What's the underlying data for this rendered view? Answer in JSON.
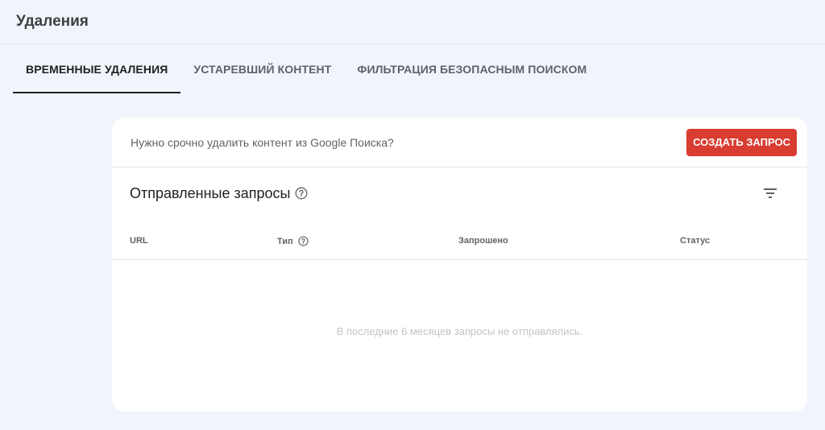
{
  "page": {
    "title": "Удаления"
  },
  "tabs": [
    {
      "label": "ВРЕМЕННЫЕ УДАЛЕНИЯ",
      "active": true
    },
    {
      "label": "УСТАРЕВШИЙ КОНТЕНТ",
      "active": false
    },
    {
      "label": "ФИЛЬТРАЦИЯ БЕЗОПАСНЫМ ПОИСКОМ",
      "active": false
    }
  ],
  "banner": {
    "text": "Нужно срочно удалить контент из Google Поиска?",
    "button_label": "СОЗДАТЬ ЗАПРОС"
  },
  "requests": {
    "title": "Отправленные запросы",
    "columns": [
      "URL",
      "Тип",
      "Запрошено",
      "Статус"
    ],
    "empty_text": "В последние 6 месяцев запросы не отправлялись."
  },
  "colors": {
    "accent_button": "#d93c31",
    "background": "#f1f4fb",
    "card": "#ffffff"
  },
  "icons": {
    "help": "help-circle-icon",
    "filter": "filter-icon"
  }
}
